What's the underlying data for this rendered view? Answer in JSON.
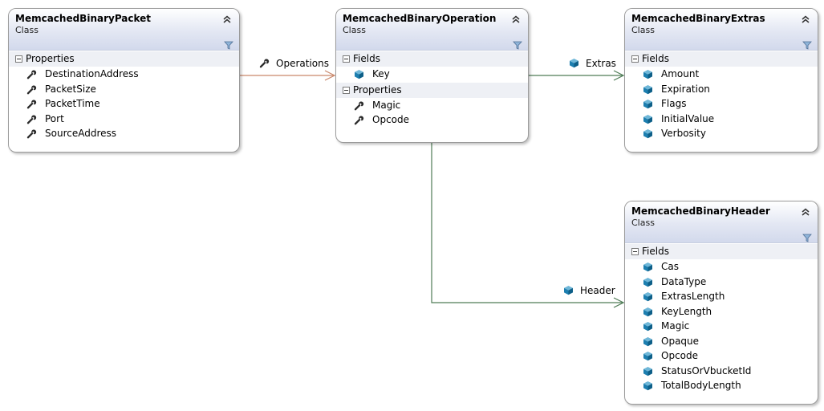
{
  "diagram": {
    "classes": {
      "packet": {
        "name": "MemcachedBinaryPacket",
        "kind": "Class",
        "sections": [
          {
            "title": "Properties",
            "icon": "wrench-icon",
            "members": [
              "DestinationAddress",
              "PacketSize",
              "PacketTime",
              "Port",
              "SourceAddress"
            ]
          }
        ]
      },
      "operation": {
        "name": "MemcachedBinaryOperation",
        "kind": "Class",
        "sections": [
          {
            "title": "Fields",
            "icon": "field-cube-icon",
            "members": [
              "Key"
            ]
          },
          {
            "title": "Properties",
            "icon": "wrench-icon",
            "members": [
              "Magic",
              "Opcode"
            ]
          }
        ]
      },
      "extras": {
        "name": "MemcachedBinaryExtras",
        "kind": "Class",
        "sections": [
          {
            "title": "Fields",
            "icon": "field-cube-icon",
            "members": [
              "Amount",
              "Expiration",
              "Flags",
              "InitialValue",
              "Verbosity"
            ]
          }
        ]
      },
      "header": {
        "name": "MemcachedBinaryHeader",
        "kind": "Class",
        "sections": [
          {
            "title": "Fields",
            "icon": "field-cube-icon",
            "members": [
              "Cas",
              "DataType",
              "ExtrasLength",
              "KeyLength",
              "Magic",
              "Opaque",
              "Opcode",
              "StatusOrVbucketId",
              "TotalBodyLength"
            ]
          }
        ]
      }
    },
    "associations": {
      "operations": {
        "label": "Operations",
        "icon": "wrench-icon",
        "color": "#c9876a"
      },
      "extras": {
        "label": "Extras",
        "icon": "field-cube-icon",
        "color": "#4f7c56"
      },
      "header": {
        "label": "Header",
        "icon": "field-cube-icon",
        "color": "#4f7c56"
      }
    },
    "colors": {
      "header_gradient_end": "#d2d9ec",
      "section_bg": "#eef0f5",
      "border": "#9b9b9b"
    }
  }
}
